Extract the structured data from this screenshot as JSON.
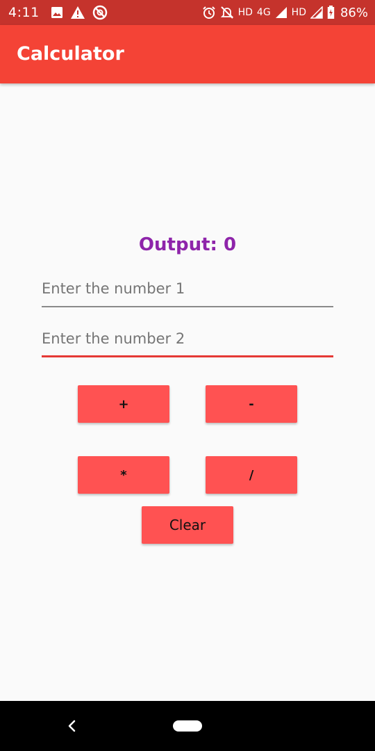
{
  "status_bar": {
    "time": "4:11",
    "network_labels": [
      "HD",
      "4G",
      "HD"
    ],
    "battery": "86%",
    "icons": [
      "image-icon",
      "warning-icon",
      "do-not-disturb-icon",
      "alarm-icon",
      "notifications-off-icon",
      "signal-icon",
      "battery-icon"
    ]
  },
  "app_bar": {
    "title": "Calculator",
    "color": "#f44336"
  },
  "output": {
    "text": "Output: 0",
    "color": "#8e24aa"
  },
  "inputs": {
    "number1": {
      "placeholder": "Enter the number 1",
      "value": ""
    },
    "number2": {
      "placeholder": "Enter the number 2",
      "value": ""
    }
  },
  "buttons": {
    "add": "+",
    "subtract": "-",
    "multiply": "*",
    "divide": "/",
    "clear": "Clear",
    "color": "#ff5252"
  },
  "nav_bar": {
    "icons": [
      "back-icon",
      "home-pill-icon"
    ]
  }
}
